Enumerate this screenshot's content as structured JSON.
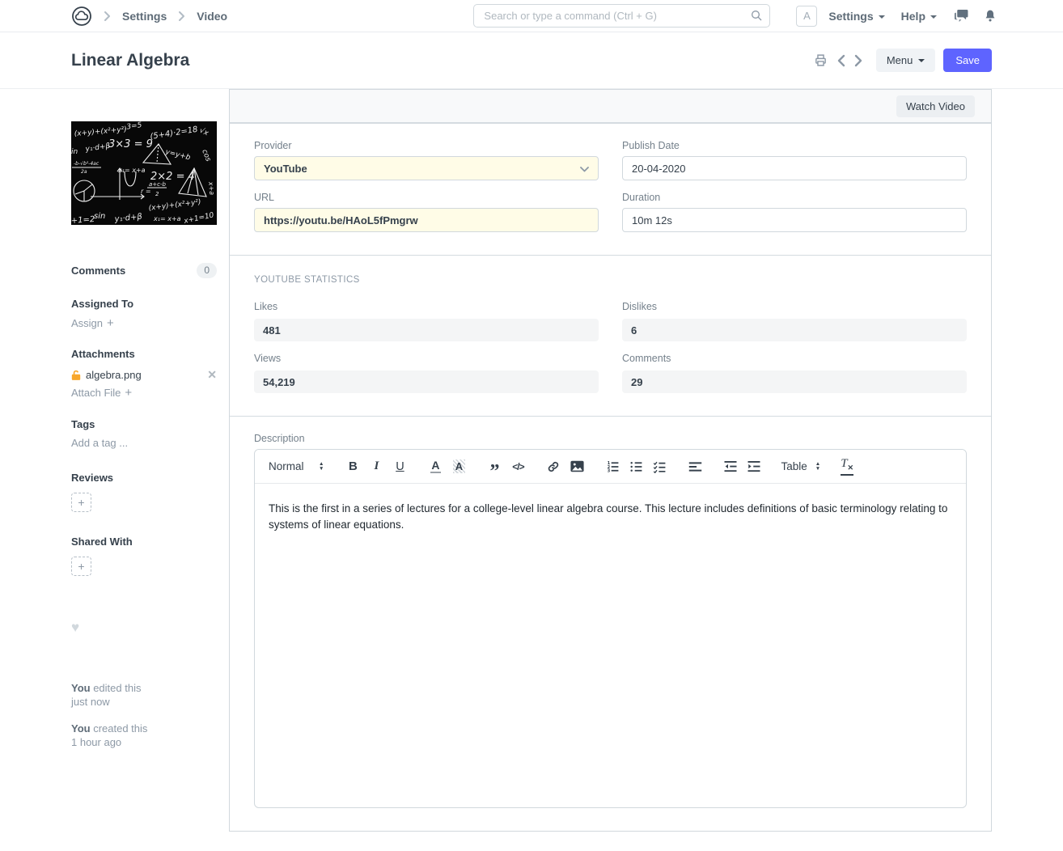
{
  "navbar": {
    "breadcrumbs": [
      "Settings",
      "Video"
    ],
    "search_placeholder": "Search or type a command (Ctrl + G)",
    "avatar_letter": "A",
    "settings_label": "Settings",
    "help_label": "Help"
  },
  "page_header": {
    "title": "Linear Algebra",
    "menu_label": "Menu",
    "save_label": "Save"
  },
  "sidebar": {
    "comments_label": "Comments",
    "comments_count": "0",
    "assigned_to_label": "Assigned To",
    "assign_label": "Assign",
    "attachments_label": "Attachments",
    "attachment_file": "algebra.png",
    "attach_file_label": "Attach File",
    "tags_label": "Tags",
    "add_tag_placeholder": "Add a tag ...",
    "reviews_label": "Reviews",
    "shared_with_label": "Shared With",
    "activity": [
      {
        "actor": "You",
        "action": " edited this",
        "time": "just now"
      },
      {
        "actor": "You",
        "action": " created this",
        "time": "1 hour ago"
      }
    ]
  },
  "form": {
    "watch_video_label": "Watch Video",
    "provider": {
      "label": "Provider",
      "value": "YouTube"
    },
    "publish_date": {
      "label": "Publish Date",
      "value": "20-04-2020"
    },
    "url": {
      "label": "URL",
      "value": "https://youtu.be/HAoL5fPmgrw"
    },
    "duration": {
      "label": "Duration",
      "value": "10m 12s"
    },
    "statistics": {
      "section_title": "YouTube Statistics",
      "likes": {
        "label": "Likes",
        "value": "481"
      },
      "dislikes": {
        "label": "Dislikes",
        "value": "6"
      },
      "views": {
        "label": "Views",
        "value": "54,219"
      },
      "comments": {
        "label": "Comments",
        "value": "29"
      }
    },
    "description": {
      "label": "Description",
      "format_selector": "Normal",
      "table_selector": "Table",
      "text": "This is the first in a series of lectures for a college-level linear algebra course. This lecture includes definitions of basic terminology relating to systems of linear equations."
    }
  },
  "colors": {
    "accent": "#5e64ff",
    "mandatory_bg": "#fffce7",
    "readonly_bg": "#f4f5f6",
    "border": "#d1d8dd",
    "attachment_lock": "#f8a72c"
  }
}
